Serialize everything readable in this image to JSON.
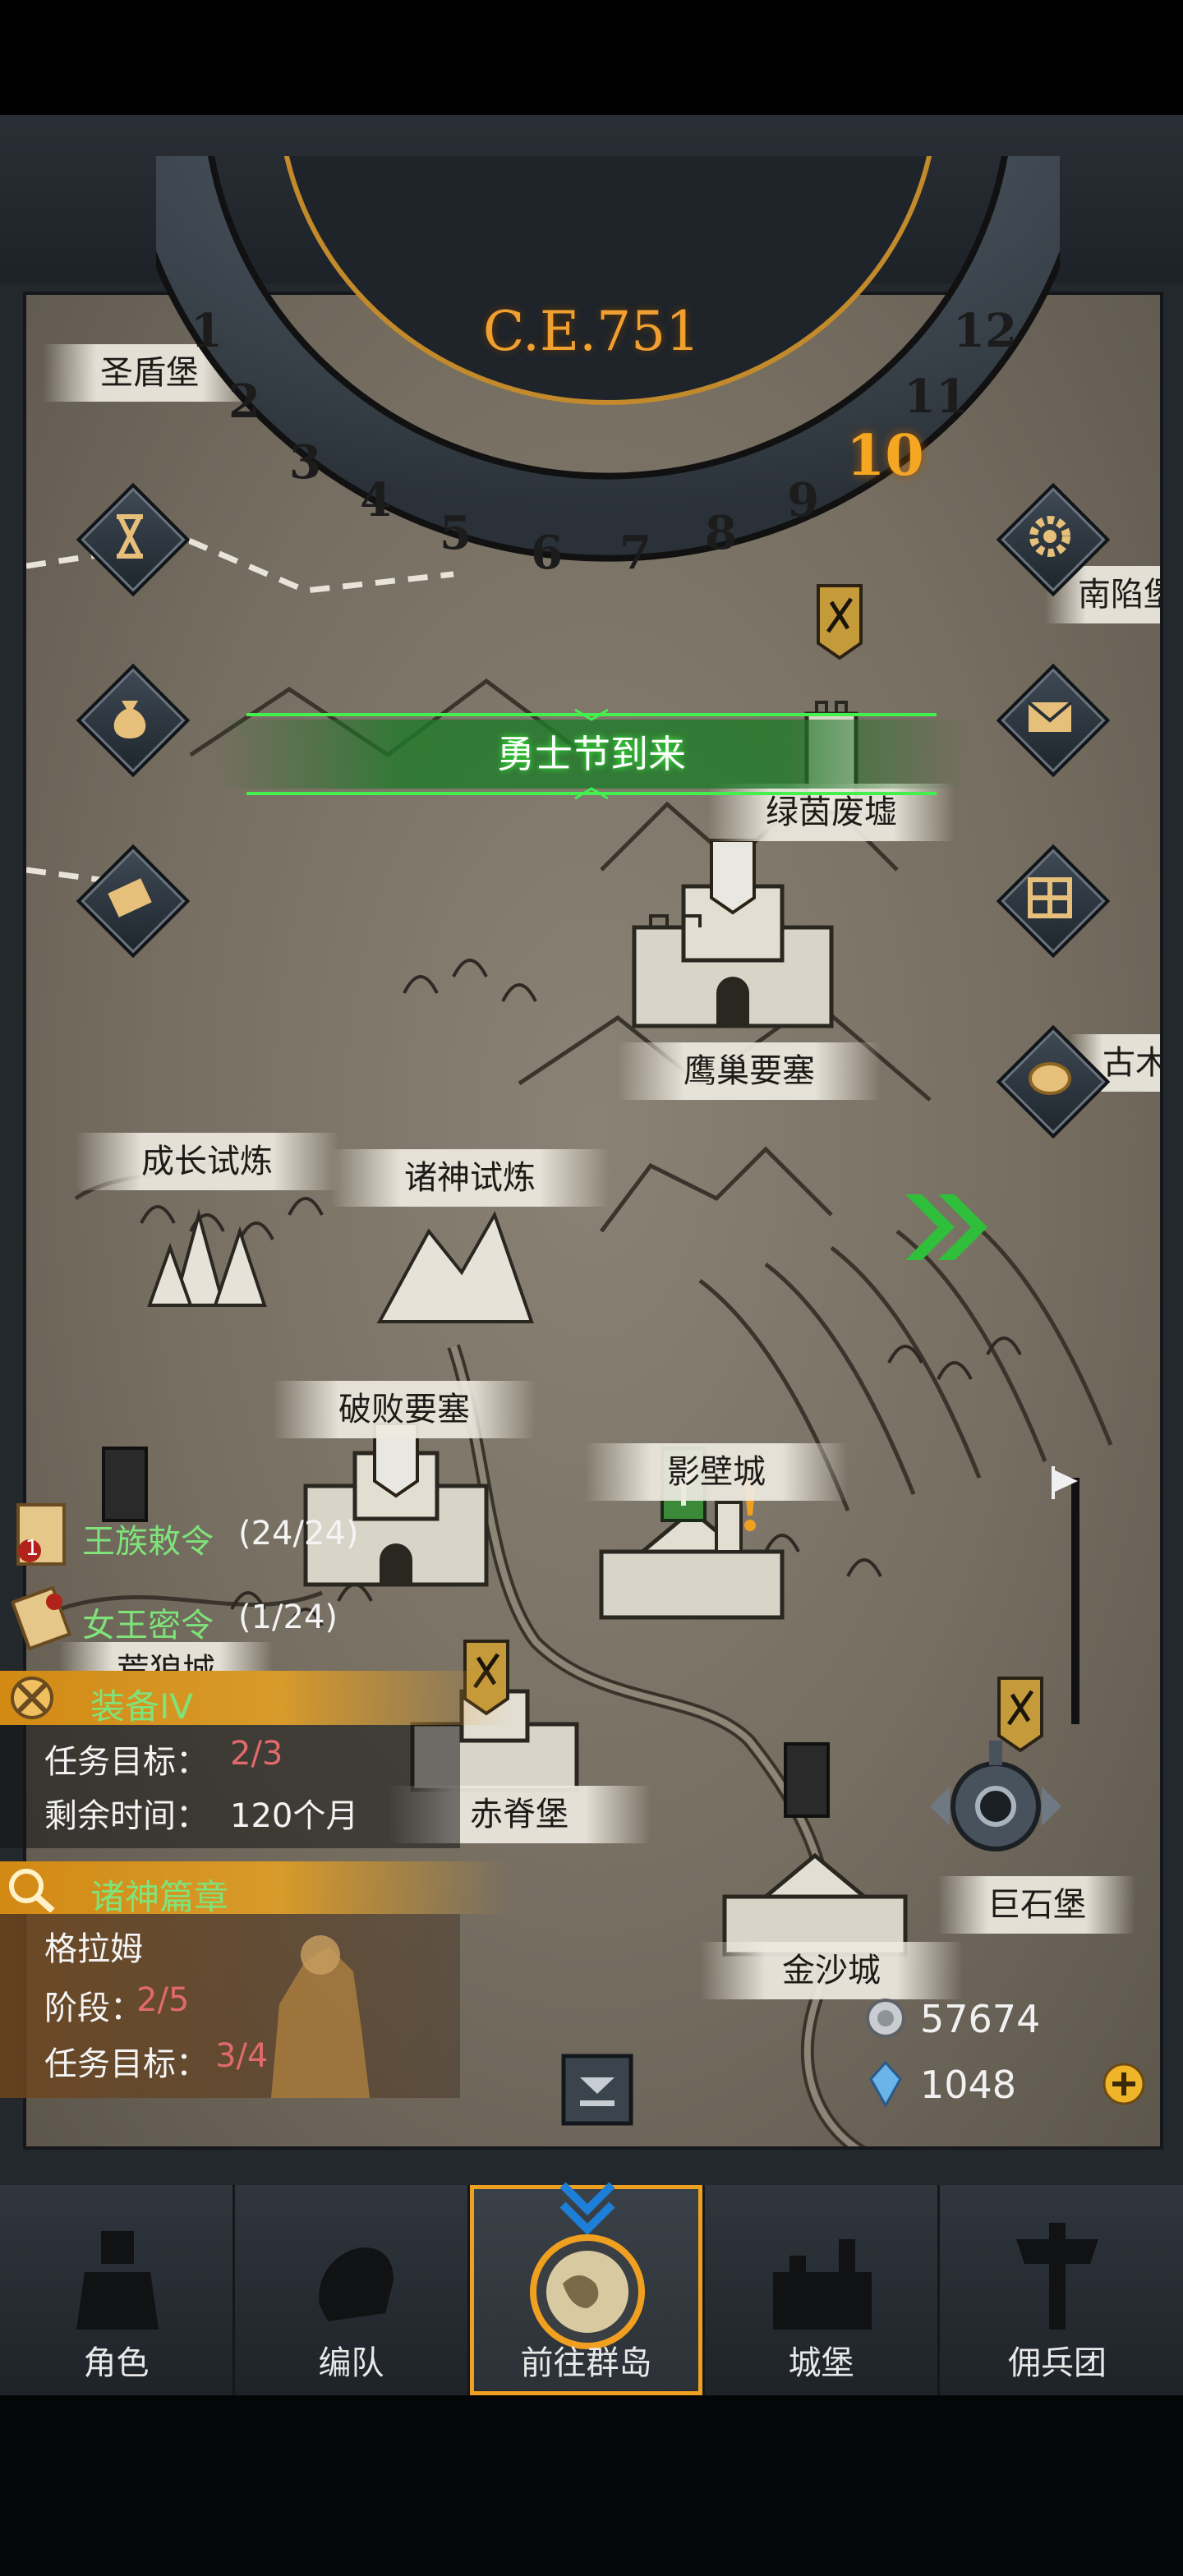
{
  "calendar": {
    "era": "C.E.751",
    "months": [
      "1",
      "2",
      "3",
      "4",
      "5",
      "6",
      "7",
      "8",
      "9",
      "10",
      "11",
      "12"
    ],
    "current_month": "10"
  },
  "banner": {
    "text": "勇士节到来"
  },
  "side_buttons_left": [
    {
      "icon": "hourglass-icon"
    },
    {
      "icon": "money-bag-icon"
    },
    {
      "icon": "scroll-icon"
    }
  ],
  "side_buttons_right": [
    {
      "icon": "gear-icon"
    },
    {
      "icon": "mail-icon"
    },
    {
      "icon": "grid-box-icon"
    },
    {
      "icon": "coin-icon"
    }
  ],
  "locations": {
    "shengdun": "圣盾堡",
    "nanxian": "南陷堡",
    "lvyin": "绿茵废墟",
    "yingchao": "鹰巢要塞",
    "gumu": "古木",
    "chengzhang": "成长试炼",
    "zhushen": "诸神试炼",
    "pobai": "破败要塞",
    "yingbi": "影壁城",
    "huanglang": "荒狼城",
    "chiji": "赤脊堡",
    "jinsha": "金沙城",
    "jushi": "巨石堡"
  },
  "quests": {
    "royal_decree": {
      "label": "王族敕令",
      "count": "(24/24)",
      "badge": "1"
    },
    "queen_order": {
      "label": "女王密令",
      "count": "(1/24)"
    },
    "equipment": {
      "title": "装备IV",
      "target_label": "任务目标：",
      "target_value": "2/3",
      "time_label": "剩余时间：",
      "time_value": "120个月"
    },
    "gods": {
      "title": "诸神篇章",
      "name": "格拉姆",
      "stage_label": "阶段：",
      "stage_value": "2/5",
      "target_label": "任务目标：",
      "target_value": "3/4"
    }
  },
  "resources": {
    "silver": "57674",
    "crystal": "1048"
  },
  "nav": [
    {
      "label": "角色",
      "icon": "knight-icon"
    },
    {
      "label": "编队",
      "icon": "helmet-icon"
    },
    {
      "label": "前往群岛",
      "icon": "globe-icon",
      "active": true
    },
    {
      "label": "城堡",
      "icon": "castle-icon"
    },
    {
      "label": "佣兵团",
      "icon": "mercenary-icon"
    }
  ],
  "colors": {
    "accent_gold": "#f0a020",
    "quest_green": "#7fe37a",
    "progress_red": "#e06a6a",
    "banner_green": "#3cd64a"
  }
}
